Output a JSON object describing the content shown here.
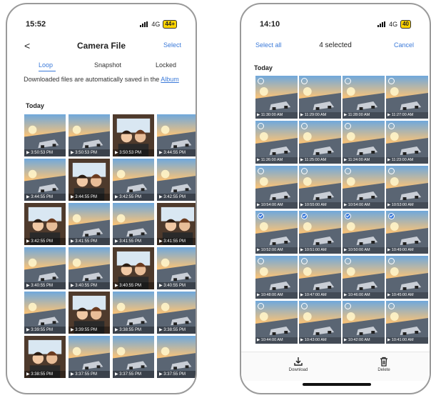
{
  "left": {
    "status": {
      "time": "15:52",
      "network": "4G",
      "battery": "44+"
    },
    "header": {
      "back": "<",
      "title": "Camera File",
      "select": "Select"
    },
    "tabs": {
      "loop": "Loop",
      "snapshot": "Snapshot",
      "locked": "Locked"
    },
    "notice": {
      "text": "Downloaded files are automatically saved in the",
      "link": "Album"
    },
    "section": "Today",
    "cells": [
      {
        "label": "3:50:53 PM",
        "style": "road"
      },
      {
        "label": "3:50:53 PM",
        "style": "road"
      },
      {
        "label": "3:50:53 PM",
        "style": "cabin"
      },
      {
        "label": "3:44:55 PM",
        "style": "road"
      },
      {
        "label": "3:44:55 PM",
        "style": "road"
      },
      {
        "label": "3:44:55 PM",
        "style": "cabin"
      },
      {
        "label": "3:42:55 PM",
        "style": "road"
      },
      {
        "label": "3:42:55 PM",
        "style": "road"
      },
      {
        "label": "3:42:55 PM",
        "style": "cabin"
      },
      {
        "label": "3:41:55 PM",
        "style": "road"
      },
      {
        "label": "3:41:55 PM",
        "style": "road"
      },
      {
        "label": "3:41:55 PM",
        "style": "cabin"
      },
      {
        "label": "3:40:55 PM",
        "style": "road"
      },
      {
        "label": "3:40:55 PM",
        "style": "road"
      },
      {
        "label": "3:40:55 PM",
        "style": "cabin"
      },
      {
        "label": "3:40:55 PM",
        "style": "road"
      },
      {
        "label": "3:39:55 PM",
        "style": "road"
      },
      {
        "label": "3:39:55 PM",
        "style": "cabin"
      },
      {
        "label": "3:38:55 PM",
        "style": "road"
      },
      {
        "label": "3:38:55 PM",
        "style": "road"
      },
      {
        "label": "3:38:55 PM",
        "style": "cabin"
      },
      {
        "label": "3:37:55 PM",
        "style": "road"
      },
      {
        "label": "3:37:55 PM",
        "style": "road"
      },
      {
        "label": "3:37:55 PM",
        "style": "road"
      }
    ]
  },
  "right": {
    "status": {
      "time": "14:10",
      "network": "4G",
      "battery": "40"
    },
    "topbar": {
      "select_all": "Select all",
      "count": "4 selected",
      "cancel": "Cancel"
    },
    "section": "Today",
    "cells": [
      {
        "label": "11:30:00 AM",
        "selected": false
      },
      {
        "label": "11:29:00 AM",
        "selected": false
      },
      {
        "label": "11:28:00 AM",
        "selected": false
      },
      {
        "label": "11:27:00 AM",
        "selected": false
      },
      {
        "label": "11:26:00 AM",
        "selected": false
      },
      {
        "label": "11:25:00 AM",
        "selected": false
      },
      {
        "label": "11:24:00 AM",
        "selected": false
      },
      {
        "label": "11:23:00 AM",
        "selected": false
      },
      {
        "label": "10:54:00 AM",
        "selected": false
      },
      {
        "label": "10:55:00 AM",
        "selected": false
      },
      {
        "label": "10:54:00 AM",
        "selected": false
      },
      {
        "label": "10:53:00 AM",
        "selected": false
      },
      {
        "label": "10:52:00 AM",
        "selected": true
      },
      {
        "label": "10:51:00 AM",
        "selected": true
      },
      {
        "label": "10:50:00 AM",
        "selected": true
      },
      {
        "label": "10:49:00 AM",
        "selected": true
      },
      {
        "label": "10:48:00 AM",
        "selected": false
      },
      {
        "label": "10:47:00 AM",
        "selected": false
      },
      {
        "label": "10:46:00 AM",
        "selected": false
      },
      {
        "label": "10:45:00 AM",
        "selected": false
      },
      {
        "label": "10:44:00 AM",
        "selected": false
      },
      {
        "label": "10:43:00 AM",
        "selected": false
      },
      {
        "label": "10:42:00 AM",
        "selected": false
      },
      {
        "label": "10:41:00 AM",
        "selected": false
      }
    ],
    "bottom": {
      "download": "Download",
      "delete": "Delete"
    }
  },
  "colors": {
    "accent": "#3b7ad9",
    "battery": "#ffd400",
    "selected": "#3b7ad9"
  }
}
